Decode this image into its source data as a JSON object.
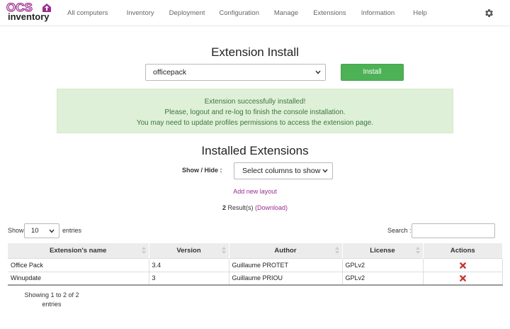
{
  "brand": {
    "top": "OCS",
    "bottom": "inventory"
  },
  "nav": {
    "items": [
      "All computers",
      "Inventory",
      "Deployment",
      "Configuration",
      "Manage",
      "Extensions",
      "Information",
      "Help"
    ]
  },
  "install": {
    "title": "Extension Install",
    "selected_extension": "officepack",
    "button_label": "Install"
  },
  "alert": {
    "line1": "Extension successfully installed!",
    "line2": "Please, logout and re-log to finish the console installation.",
    "line3": "You may need to update profiles permissions to access the extension page."
  },
  "installed": {
    "title": "Installed Extensions",
    "show_hide_label": "Show / Hide :",
    "columns_select": "Select columns to show",
    "add_layout": "Add new layout",
    "result_count": "2",
    "result_text": " Result(s) ",
    "download": "(Download)"
  },
  "table_controls": {
    "show_label": "Show",
    "entries_value": "10",
    "entries_label": "entries",
    "search_label": "Search :",
    "search_value": ""
  },
  "table": {
    "headers": [
      "Extension's name",
      "Version",
      "Author",
      "License",
      "Actions"
    ],
    "rows": [
      [
        "Office Pack",
        "3.4",
        "Guillaume PROTET",
        "GPLv2"
      ],
      [
        "Winupdate",
        "3",
        "Guillaume PRIOU",
        "GPLv2"
      ]
    ]
  },
  "footer": {
    "info": "Showing 1 to 2 of 2 entries"
  },
  "colors": {
    "accent": "#9b2d8e",
    "success": "#4cb255",
    "alert_bg": "#dff0d8",
    "alert_text": "#3c763d",
    "delete": "#c9302c"
  }
}
